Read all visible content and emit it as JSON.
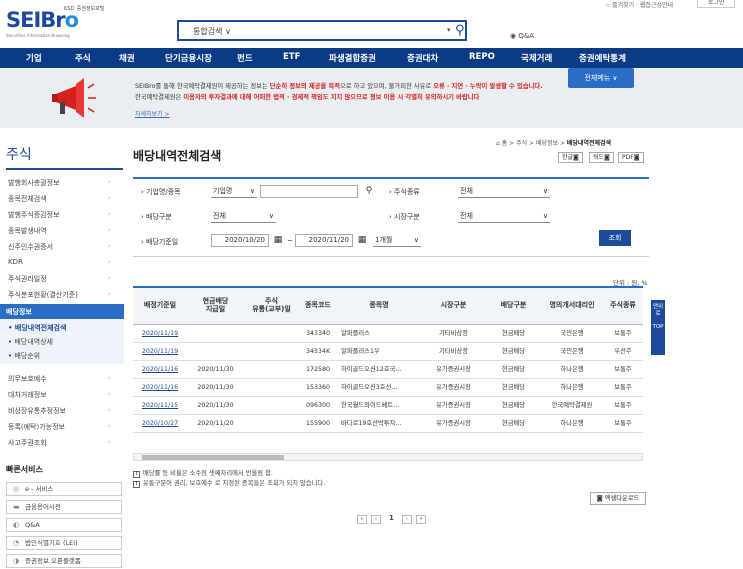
{
  "header": {
    "logo": "SEIBro",
    "logo_sub": "Securities Information Browsing",
    "ksd": "KSD",
    "ksd_sub": "증권정보포털",
    "top_links": "☆ 즐겨찾기 · 웹접근성안내",
    "top_button": "로그인",
    "search_scope": "통합검색 ∨",
    "search_value": "",
    "qa": "Q&A"
  },
  "nav": [
    "기업",
    "주식",
    "채권",
    "단기금융시장",
    "펀드",
    "ETF",
    "파생결합증권",
    "증권대차",
    "REPO",
    "국제거래",
    "증권예탁통계"
  ],
  "notice": {
    "line1_a": "SEIBro를 통해 한국예탁결제원이 제공하는 정보는 ",
    "line1_red1": "단순히 정보의 제공을 목적",
    "line1_b": "으로 하고 있으며, 불가피한 사유로 ",
    "line1_red2": "오류 · 지연 · 누락이 발생할 수 있습니다.",
    "line2_a": "한국예탁결제원은 ",
    "line2_red": "이용자의 투자결과에 대해 어떠한 법적 · 경제적 책임도 지지 않으므로 정보 이용 시 각별히 유의하시기 바랍니다",
    "more": "자세히보기 >",
    "all_menu": "전체메뉴 ∨"
  },
  "sidebar": {
    "heading": "주식",
    "items": [
      "발행회사총괄정보",
      "종목전체검색",
      "발행주식증감정보",
      "종목발생내역",
      "신주인수권증서",
      "KDR",
      "주식권리일정",
      "주식분포현황(결산기준)"
    ],
    "active": "배당정보",
    "sub_items": [
      "• 배당내역전체검색",
      "• 배당내역상세",
      "• 배당순위"
    ],
    "items2": [
      "의무보호예수",
      "대차거래정보",
      "비상장유통추정정보",
      "등록(예탁)가능정보",
      "사고주권조회"
    ],
    "quick_title": "빠른서비스",
    "quick": [
      {
        "icon": "◎",
        "label": "e - 서비스"
      },
      {
        "icon": "▬",
        "label": "금융용어사전"
      },
      {
        "icon": "◐",
        "label": "Q&A"
      },
      {
        "icon": "◔",
        "label": "법인식별기호 (LEI)"
      },
      {
        "icon": "◑",
        "label": "증권정보 오픈플랫폼"
      }
    ]
  },
  "page": {
    "breadcrumb_home": "⌂ 홈 > 주식 > 배당정보 > ",
    "breadcrumb_current": "배당내역전체검색",
    "title": "배당내역전체검색",
    "chips": [
      "한글◙",
      "워드◙",
      "PDF◙"
    ]
  },
  "form": {
    "lbl_company": "› 기업명/종목",
    "company_select": "기업명",
    "company_input": "",
    "lbl_stock_type": "› 주식종류",
    "stock_type": "전체",
    "lbl_div_type": "› 배당구분",
    "div_type": "전체",
    "lbl_market": "› 시장구분",
    "market": "전체",
    "lbl_date": "› 배당기준일",
    "date_from": "2020/10/20",
    "date_to": "2020/11/20",
    "period": "1개월",
    "search_button": "조회"
  },
  "unit": "단위 : 원, %",
  "table": {
    "headers": [
      "배정기준일",
      "현금배당\n지급일",
      "주식\n유통(교부)일",
      "종목코드",
      "종목명",
      "시장구분",
      "배당구분",
      "명의개서대리인",
      "주식종류"
    ],
    "rows": [
      [
        "2020/11/19",
        "",
        "",
        "343340",
        "알파플러스",
        "기타비상장",
        "현금배당",
        "국민은행",
        "보통주"
      ],
      [
        "2020/11/19",
        "",
        "",
        "34334K",
        "알파플러스1우",
        "기타비상장",
        "현금배당",
        "국민은행",
        "우선주"
      ],
      [
        "2020/11/16",
        "2020/11/30",
        "",
        "172580",
        "하이골드오션12호국…",
        "유가증권시장",
        "현금배당",
        "하나은행",
        "보통주"
      ],
      [
        "2020/11/16",
        "2020/11/30",
        "",
        "153360",
        "하이골드오션3호선…",
        "유가증권시장",
        "현금배당",
        "하나은행",
        "보통주"
      ],
      [
        "2020/11/15",
        "2020/11/30",
        "",
        "096300",
        "한국월드와이드베트…",
        "유가증권시장",
        "현금배당",
        "한국예탁결제원",
        "보통주"
      ],
      [
        "2020/10/27",
        "2020/11/20",
        "",
        "155900",
        "바다로19호선박투자…",
        "유가증권시장",
        "현금배당",
        "하나은행",
        "보통주"
      ]
    ]
  },
  "notes": [
    "배당률 등 비율은 소수점 셋째자리에서 반올림 함.",
    "유통구분이 권리, 보호예수 로 지정된 종목들은 조회가 되지 않습니다."
  ],
  "excel": "◙ 엑셀다운로드",
  "pager": {
    "current": "1"
  },
  "float": {
    "label": "맨위로",
    "top": "TOP"
  },
  "colors": {
    "primary": "#1d4a9c",
    "accent": "#2b6cc4",
    "red": "#d3211b"
  }
}
